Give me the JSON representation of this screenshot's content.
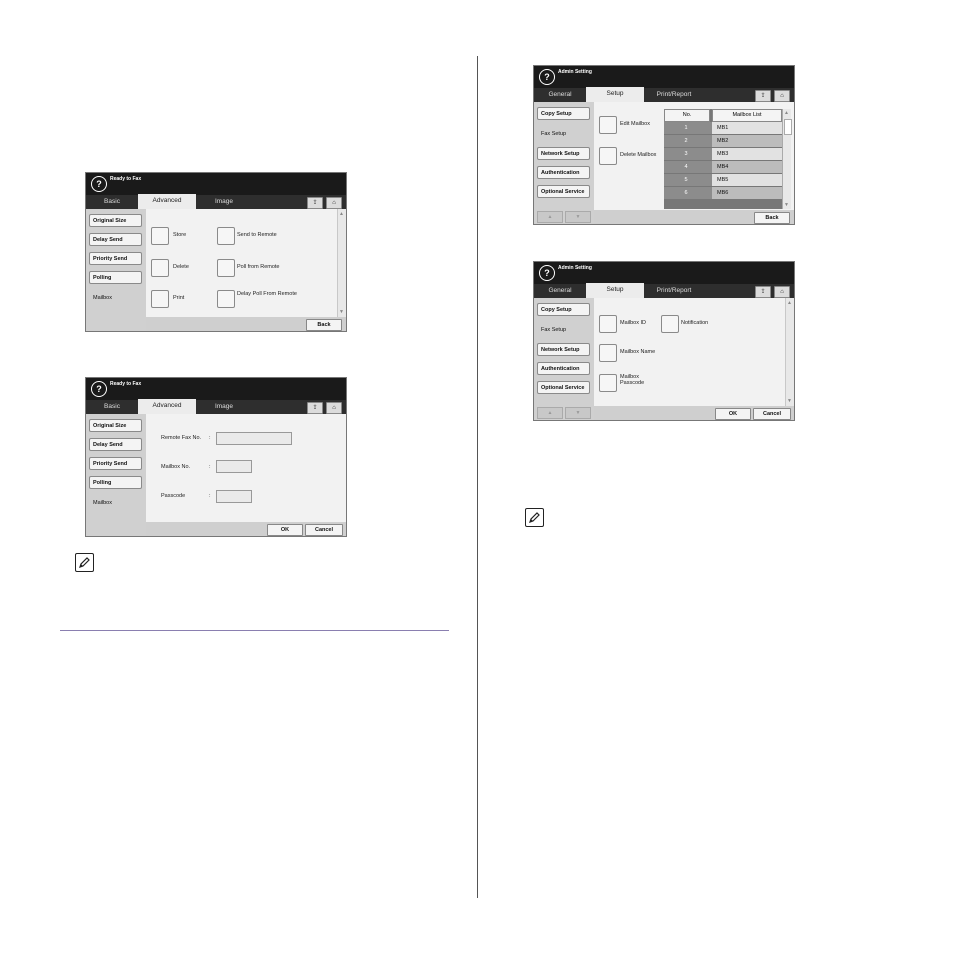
{
  "screen1": {
    "title": "Ready to Fax",
    "tabs": [
      "Basic",
      "Advanced",
      "Image"
    ],
    "sidebar": [
      "Original Size",
      "Delay Send",
      "Priority Send",
      "Polling",
      "Mailbox"
    ],
    "options": [
      "Store",
      "Send to Remote",
      "Delete",
      "Poll from Remote",
      "Print",
      "Delay Poll From Remote"
    ],
    "back": "Back"
  },
  "screen2": {
    "title": "Ready to Fax",
    "tabs": [
      "Basic",
      "Advanced",
      "Image"
    ],
    "sidebar": [
      "Original Size",
      "Delay Send",
      "Priority Send",
      "Polling",
      "Mailbox"
    ],
    "fields": [
      "Remote Fax No.",
      "Mailbox No.",
      "Passcode"
    ],
    "colon": ":",
    "ok": "OK",
    "cancel": "Cancel"
  },
  "screen3": {
    "title": "Admin Setting",
    "tabs": [
      "General",
      "Setup",
      "Print/Report"
    ],
    "sidebar": [
      "Copy Setup",
      "Fax Setup",
      "Network Setup",
      "Authentication",
      "Optional Service"
    ],
    "options": [
      "Edit Mailbox",
      "Delete Mailbox"
    ],
    "table_headers": [
      "No.",
      "Mailbox List"
    ],
    "rows": [
      {
        "no": "1",
        "name": "MB1"
      },
      {
        "no": "2",
        "name": "MB2"
      },
      {
        "no": "3",
        "name": "MB3"
      },
      {
        "no": "4",
        "name": "MB4"
      },
      {
        "no": "5",
        "name": "MB5"
      },
      {
        "no": "6",
        "name": "MB6"
      }
    ],
    "back": "Back"
  },
  "screen4": {
    "title": "Admin Setting",
    "tabs": [
      "General",
      "Setup",
      "Print/Report"
    ],
    "sidebar": [
      "Copy Setup",
      "Fax Setup",
      "Network Setup",
      "Authentication",
      "Optional Service"
    ],
    "options": [
      "Mailbox ID",
      "Notification",
      "Mailbox Name",
      "Mailbox Passcode"
    ],
    "ok": "OK",
    "cancel": "Cancel"
  },
  "icons": {
    "help": "?",
    "upload": "upload-icon",
    "home": "home-icon",
    "note": "note-pencil-icon"
  }
}
